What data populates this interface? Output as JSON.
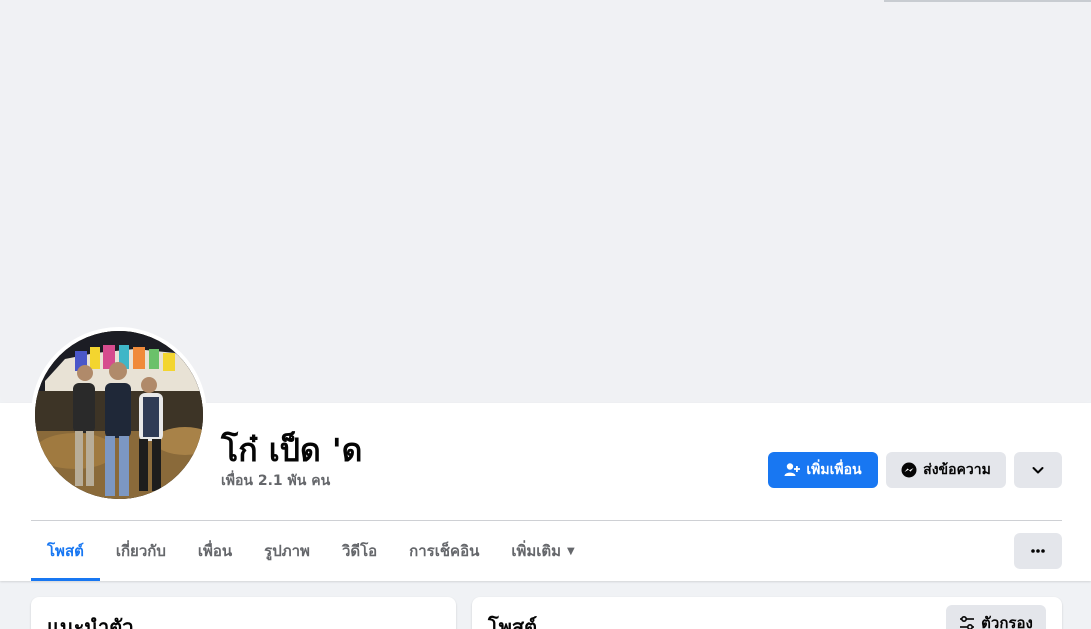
{
  "profile": {
    "name": "โก๋ เป็ด 'ด",
    "friends_count": "เพื่อน 2.1 พัน คน"
  },
  "actions": {
    "add_friend": "เพิ่มเพื่อน",
    "message": "ส่งข้อความ"
  },
  "tabs": [
    {
      "label": "โพสต์",
      "active": true
    },
    {
      "label": "เกี่ยวกับ",
      "active": false
    },
    {
      "label": "เพื่อน",
      "active": false
    },
    {
      "label": "รูปภาพ",
      "active": false
    },
    {
      "label": "วิดีโอ",
      "active": false
    },
    {
      "label": "การเช็คอิน",
      "active": false
    },
    {
      "label": "เพิ่มเติม",
      "active": false
    }
  ],
  "intro_card": {
    "title": "แนะนำตัว"
  },
  "posts_card": {
    "title": "โพสต์",
    "filter_label": "ตัวกรอง"
  },
  "colors": {
    "accent": "#1877f2",
    "secondary_button": "#e4e6eb",
    "cover": "#f0f1f4"
  }
}
